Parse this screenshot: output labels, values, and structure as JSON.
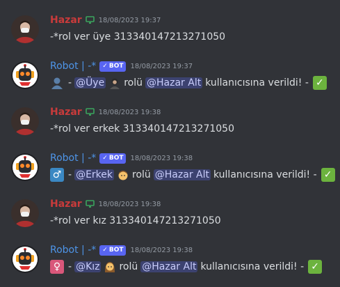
{
  "messages": [
    {
      "author": "Hazar",
      "timestamp": "18/08/2023 19:37",
      "text": "-*rol ver üye 313340147213271050"
    },
    {
      "author": "Robot | -*",
      "badge": "BOT",
      "timestamp": "18/08/2023 19:37",
      "dash1": "-",
      "role_mention": "@Üye",
      "middle": "rolü",
      "user_mention": "@Hazar Alt",
      "tail": "kullanıcısına verildi! -",
      "emoji": "bust-in-silhouette"
    },
    {
      "author": "Hazar",
      "timestamp": "18/08/2023 19:38",
      "text": "-*rol ver erkek 313340147213271050"
    },
    {
      "author": "Robot | -*",
      "badge": "BOT",
      "timestamp": "18/08/2023 19:38",
      "dash1": "-",
      "role_mention": "@Erkek",
      "middle": "rolü",
      "user_mention": "@Hazar Alt",
      "tail": "kullanıcısına verildi! -",
      "emoji": "male-sign"
    },
    {
      "author": "Hazar",
      "timestamp": "18/08/2023 19:38",
      "text": "-*rol ver kız 313340147213271050"
    },
    {
      "author": "Robot | -*",
      "badge": "BOT",
      "timestamp": "18/08/2023 19:38",
      "dash1": "-",
      "role_mention": "@Kız",
      "middle": "rolü",
      "user_mention": "@Hazar Alt",
      "tail": "kullanıcısına verildi! -",
      "emoji": "female-sign"
    }
  ],
  "colors": {
    "background": "#313338",
    "hazar_name": "#c93b3b",
    "robot_name": "#4e95e8",
    "bot_badge": "#5865f2",
    "mention_bg": "#3c4270",
    "check": "#6cb33e"
  },
  "glyphs": {
    "male": "♂",
    "female": "♀",
    "check": "✓",
    "badge_check": "✓"
  }
}
